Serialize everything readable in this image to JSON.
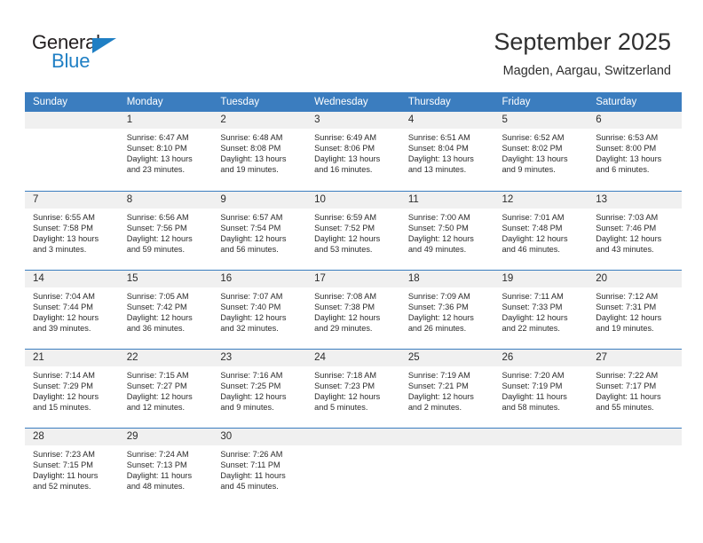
{
  "brand": {
    "name_part1": "General",
    "name_part2": "Blue",
    "accent_color": "#1f7fc4",
    "triangle_icon": "blue-triangle-icon"
  },
  "header": {
    "month_title": "September 2025",
    "location": "Magden, Aargau, Switzerland",
    "header_bg_color": "#3b7dbf",
    "daynum_bg_color": "#f0f0f0"
  },
  "calendar": {
    "weekday_headers": [
      "Sunday",
      "Monday",
      "Tuesday",
      "Wednesday",
      "Thursday",
      "Friday",
      "Saturday"
    ],
    "labels": {
      "sunrise": "Sunrise:",
      "sunset": "Sunset:",
      "daylight": "Daylight:"
    },
    "weeks": [
      [
        {
          "day": "",
          "empty": true
        },
        {
          "day": "1",
          "sunrise": "Sunrise: 6:47 AM",
          "sunset": "Sunset: 8:10 PM",
          "daylight_line1": "Daylight: 13 hours",
          "daylight_line2": "and 23 minutes."
        },
        {
          "day": "2",
          "sunrise": "Sunrise: 6:48 AM",
          "sunset": "Sunset: 8:08 PM",
          "daylight_line1": "Daylight: 13 hours",
          "daylight_line2": "and 19 minutes."
        },
        {
          "day": "3",
          "sunrise": "Sunrise: 6:49 AM",
          "sunset": "Sunset: 8:06 PM",
          "daylight_line1": "Daylight: 13 hours",
          "daylight_line2": "and 16 minutes."
        },
        {
          "day": "4",
          "sunrise": "Sunrise: 6:51 AM",
          "sunset": "Sunset: 8:04 PM",
          "daylight_line1": "Daylight: 13 hours",
          "daylight_line2": "and 13 minutes."
        },
        {
          "day": "5",
          "sunrise": "Sunrise: 6:52 AM",
          "sunset": "Sunset: 8:02 PM",
          "daylight_line1": "Daylight: 13 hours",
          "daylight_line2": "and 9 minutes."
        },
        {
          "day": "6",
          "sunrise": "Sunrise: 6:53 AM",
          "sunset": "Sunset: 8:00 PM",
          "daylight_line1": "Daylight: 13 hours",
          "daylight_line2": "and 6 minutes."
        }
      ],
      [
        {
          "day": "7",
          "sunrise": "Sunrise: 6:55 AM",
          "sunset": "Sunset: 7:58 PM",
          "daylight_line1": "Daylight: 13 hours",
          "daylight_line2": "and 3 minutes."
        },
        {
          "day": "8",
          "sunrise": "Sunrise: 6:56 AM",
          "sunset": "Sunset: 7:56 PM",
          "daylight_line1": "Daylight: 12 hours",
          "daylight_line2": "and 59 minutes."
        },
        {
          "day": "9",
          "sunrise": "Sunrise: 6:57 AM",
          "sunset": "Sunset: 7:54 PM",
          "daylight_line1": "Daylight: 12 hours",
          "daylight_line2": "and 56 minutes."
        },
        {
          "day": "10",
          "sunrise": "Sunrise: 6:59 AM",
          "sunset": "Sunset: 7:52 PM",
          "daylight_line1": "Daylight: 12 hours",
          "daylight_line2": "and 53 minutes."
        },
        {
          "day": "11",
          "sunrise": "Sunrise: 7:00 AM",
          "sunset": "Sunset: 7:50 PM",
          "daylight_line1": "Daylight: 12 hours",
          "daylight_line2": "and 49 minutes."
        },
        {
          "day": "12",
          "sunrise": "Sunrise: 7:01 AM",
          "sunset": "Sunset: 7:48 PM",
          "daylight_line1": "Daylight: 12 hours",
          "daylight_line2": "and 46 minutes."
        },
        {
          "day": "13",
          "sunrise": "Sunrise: 7:03 AM",
          "sunset": "Sunset: 7:46 PM",
          "daylight_line1": "Daylight: 12 hours",
          "daylight_line2": "and 43 minutes."
        }
      ],
      [
        {
          "day": "14",
          "sunrise": "Sunrise: 7:04 AM",
          "sunset": "Sunset: 7:44 PM",
          "daylight_line1": "Daylight: 12 hours",
          "daylight_line2": "and 39 minutes."
        },
        {
          "day": "15",
          "sunrise": "Sunrise: 7:05 AM",
          "sunset": "Sunset: 7:42 PM",
          "daylight_line1": "Daylight: 12 hours",
          "daylight_line2": "and 36 minutes."
        },
        {
          "day": "16",
          "sunrise": "Sunrise: 7:07 AM",
          "sunset": "Sunset: 7:40 PM",
          "daylight_line1": "Daylight: 12 hours",
          "daylight_line2": "and 32 minutes."
        },
        {
          "day": "17",
          "sunrise": "Sunrise: 7:08 AM",
          "sunset": "Sunset: 7:38 PM",
          "daylight_line1": "Daylight: 12 hours",
          "daylight_line2": "and 29 minutes."
        },
        {
          "day": "18",
          "sunrise": "Sunrise: 7:09 AM",
          "sunset": "Sunset: 7:36 PM",
          "daylight_line1": "Daylight: 12 hours",
          "daylight_line2": "and 26 minutes."
        },
        {
          "day": "19",
          "sunrise": "Sunrise: 7:11 AM",
          "sunset": "Sunset: 7:33 PM",
          "daylight_line1": "Daylight: 12 hours",
          "daylight_line2": "and 22 minutes."
        },
        {
          "day": "20",
          "sunrise": "Sunrise: 7:12 AM",
          "sunset": "Sunset: 7:31 PM",
          "daylight_line1": "Daylight: 12 hours",
          "daylight_line2": "and 19 minutes."
        }
      ],
      [
        {
          "day": "21",
          "sunrise": "Sunrise: 7:14 AM",
          "sunset": "Sunset: 7:29 PM",
          "daylight_line1": "Daylight: 12 hours",
          "daylight_line2": "and 15 minutes."
        },
        {
          "day": "22",
          "sunrise": "Sunrise: 7:15 AM",
          "sunset": "Sunset: 7:27 PM",
          "daylight_line1": "Daylight: 12 hours",
          "daylight_line2": "and 12 minutes."
        },
        {
          "day": "23",
          "sunrise": "Sunrise: 7:16 AM",
          "sunset": "Sunset: 7:25 PM",
          "daylight_line1": "Daylight: 12 hours",
          "daylight_line2": "and 9 minutes."
        },
        {
          "day": "24",
          "sunrise": "Sunrise: 7:18 AM",
          "sunset": "Sunset: 7:23 PM",
          "daylight_line1": "Daylight: 12 hours",
          "daylight_line2": "and 5 minutes."
        },
        {
          "day": "25",
          "sunrise": "Sunrise: 7:19 AM",
          "sunset": "Sunset: 7:21 PM",
          "daylight_line1": "Daylight: 12 hours",
          "daylight_line2": "and 2 minutes."
        },
        {
          "day": "26",
          "sunrise": "Sunrise: 7:20 AM",
          "sunset": "Sunset: 7:19 PM",
          "daylight_line1": "Daylight: 11 hours",
          "daylight_line2": "and 58 minutes."
        },
        {
          "day": "27",
          "sunrise": "Sunrise: 7:22 AM",
          "sunset": "Sunset: 7:17 PM",
          "daylight_line1": "Daylight: 11 hours",
          "daylight_line2": "and 55 minutes."
        }
      ],
      [
        {
          "day": "28",
          "sunrise": "Sunrise: 7:23 AM",
          "sunset": "Sunset: 7:15 PM",
          "daylight_line1": "Daylight: 11 hours",
          "daylight_line2": "and 52 minutes."
        },
        {
          "day": "29",
          "sunrise": "Sunrise: 7:24 AM",
          "sunset": "Sunset: 7:13 PM",
          "daylight_line1": "Daylight: 11 hours",
          "daylight_line2": "and 48 minutes."
        },
        {
          "day": "30",
          "sunrise": "Sunrise: 7:26 AM",
          "sunset": "Sunset: 7:11 PM",
          "daylight_line1": "Daylight: 11 hours",
          "daylight_line2": "and 45 minutes."
        },
        {
          "day": "",
          "empty": true
        },
        {
          "day": "",
          "empty": true
        },
        {
          "day": "",
          "empty": true
        },
        {
          "day": "",
          "empty": true
        }
      ]
    ]
  }
}
